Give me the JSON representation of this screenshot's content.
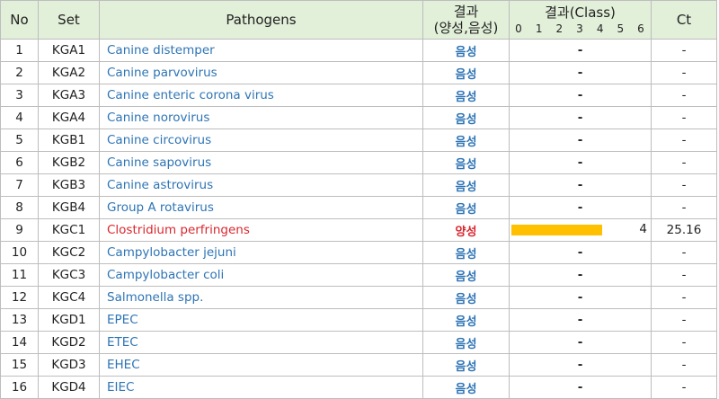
{
  "headers": {
    "no": "No",
    "set": "Set",
    "pathogens": "Pathogens",
    "result_line1": "결과",
    "result_line2": "(양성,음성)",
    "class_title": "결과(Class)",
    "class_ticks": [
      "0",
      "1",
      "2",
      "3",
      "4",
      "5",
      "6"
    ],
    "ct": "Ct"
  },
  "colors": {
    "header_bg": "#e2efd9",
    "negative_text": "#2e74b5",
    "positive_text": "#d9272e",
    "bar": "#ffc000",
    "grid": "#bdbdbd"
  },
  "class_max": 6,
  "rows": [
    {
      "no": "1",
      "set": "KGA1",
      "pathogen": "Canine distemper",
      "result": "음성",
      "positive": false,
      "class_value": null,
      "class_text": "-",
      "ct": "-"
    },
    {
      "no": "2",
      "set": "KGA2",
      "pathogen": "Canine parvovirus",
      "result": "음성",
      "positive": false,
      "class_value": null,
      "class_text": "-",
      "ct": "-"
    },
    {
      "no": "3",
      "set": "KGA3",
      "pathogen": "Canine enteric corona virus",
      "result": "음성",
      "positive": false,
      "class_value": null,
      "class_text": "-",
      "ct": "-"
    },
    {
      "no": "4",
      "set": "KGA4",
      "pathogen": "Canine norovirus",
      "result": "음성",
      "positive": false,
      "class_value": null,
      "class_text": "-",
      "ct": "-"
    },
    {
      "no": "5",
      "set": "KGB1",
      "pathogen": "Canine circovirus",
      "result": "음성",
      "positive": false,
      "class_value": null,
      "class_text": "-",
      "ct": "-"
    },
    {
      "no": "6",
      "set": "KGB2",
      "pathogen": "Canine sapovirus",
      "result": "음성",
      "positive": false,
      "class_value": null,
      "class_text": "-",
      "ct": "-"
    },
    {
      "no": "7",
      "set": "KGB3",
      "pathogen": "Canine astrovirus",
      "result": "음성",
      "positive": false,
      "class_value": null,
      "class_text": "-",
      "ct": "-"
    },
    {
      "no": "8",
      "set": "KGB4",
      "pathogen": "Group A rotavirus",
      "result": "음성",
      "positive": false,
      "class_value": null,
      "class_text": "-",
      "ct": "-"
    },
    {
      "no": "9",
      "set": "KGC1",
      "pathogen": "Clostridium perfringens",
      "result": "양성",
      "positive": true,
      "class_value": 4,
      "class_text": "4",
      "ct": "25.16"
    },
    {
      "no": "10",
      "set": "KGC2",
      "pathogen": "Campylobacter jejuni",
      "result": "음성",
      "positive": false,
      "class_value": null,
      "class_text": "-",
      "ct": "-"
    },
    {
      "no": "11",
      "set": "KGC3",
      "pathogen": "Campylobacter coli",
      "result": "음성",
      "positive": false,
      "class_value": null,
      "class_text": "-",
      "ct": "-"
    },
    {
      "no": "12",
      "set": "KGC4",
      "pathogen": "Salmonella spp.",
      "result": "음성",
      "positive": false,
      "class_value": null,
      "class_text": "-",
      "ct": "-"
    },
    {
      "no": "13",
      "set": "KGD1",
      "pathogen": "EPEC",
      "result": "음성",
      "positive": false,
      "class_value": null,
      "class_text": "-",
      "ct": "-"
    },
    {
      "no": "14",
      "set": "KGD2",
      "pathogen": "ETEC",
      "result": "음성",
      "positive": false,
      "class_value": null,
      "class_text": "-",
      "ct": "-"
    },
    {
      "no": "15",
      "set": "KGD3",
      "pathogen": "EHEC",
      "result": "음성",
      "positive": false,
      "class_value": null,
      "class_text": "-",
      "ct": "-"
    },
    {
      "no": "16",
      "set": "KGD4",
      "pathogen": "EIEC",
      "result": "음성",
      "positive": false,
      "class_value": null,
      "class_text": "-",
      "ct": "-"
    }
  ]
}
